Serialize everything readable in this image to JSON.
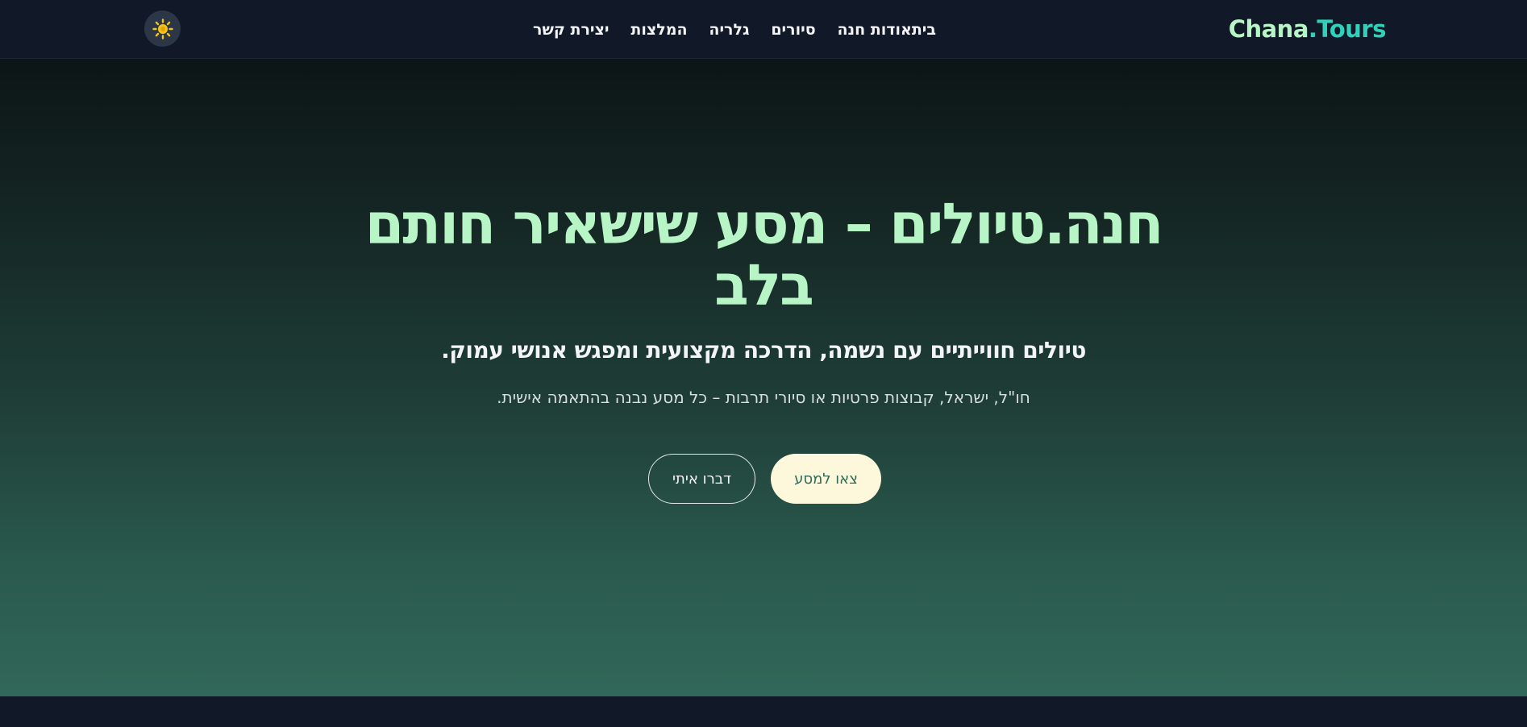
{
  "header": {
    "logo_main": "Chana",
    "logo_tld": ".Tours",
    "nav": [
      {
        "label": "ביתאודות חנה"
      },
      {
        "label": "סיורים"
      },
      {
        "label": "גלריה"
      },
      {
        "label": "המלצות"
      },
      {
        "label": "יצירת קשר"
      }
    ],
    "theme_toggle_icon": "sun-icon"
  },
  "hero": {
    "title": "חנה.טיולים – מסע שישאיר חותם בלב",
    "subtitle": "טיולים חווייתיים עם נשמה, הדרכה מקצועית ומפגש אנושי עמוק.",
    "description": "חו\"ל, ישראל, קבוצות פרטיות או סיורי תרבות – כל מסע נבנה בהתאמה אישית.",
    "primary_cta": "צאו למסע",
    "secondary_cta": "דברו איתי"
  },
  "colors": {
    "logo_main": "#b7f5c6",
    "logo_accent": "#2fd1b8",
    "header_bg": "#111827",
    "primary_button_bg": "#fdf8dc",
    "primary_button_text": "#2e6b57",
    "sun_icon": "#f5c518"
  }
}
